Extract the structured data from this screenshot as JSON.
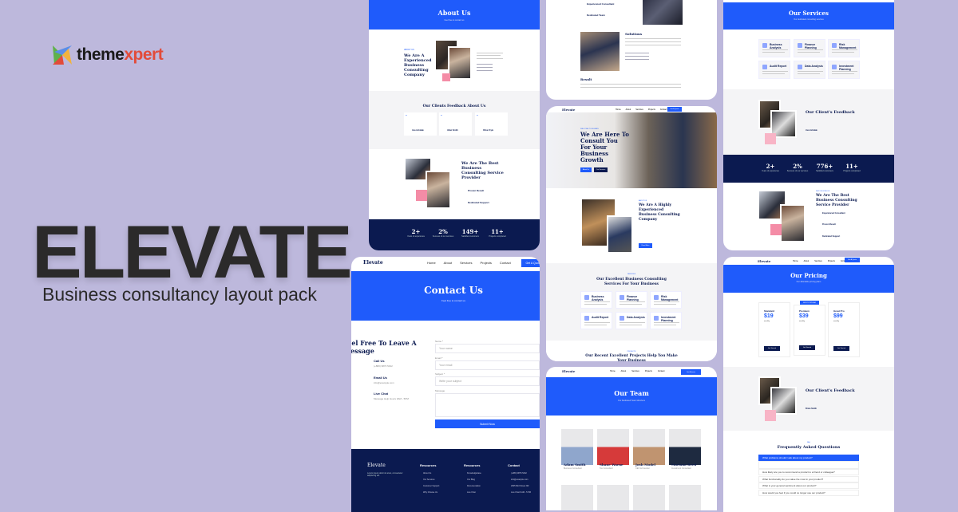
{
  "brand": {
    "logo_text": "themexpert",
    "title": "ELEVATE",
    "subtitle": "Business consultancy layout pack"
  },
  "colors": {
    "background": "#bdb8dc",
    "primary_blue": "#1f5bfb",
    "navy": "#0b1a50",
    "pink": "#f48ca6"
  },
  "about_page": {
    "hero_title": "About Us",
    "hero_sub": "Feel free to contact us",
    "section_tag": "ABOUT US",
    "heading": "We Are A Experienced Business Consulting Company",
    "feedback_tag": "TESTIMONIALS",
    "feedback_title": "Our Clients Feedback About Us",
    "testimonials": [
      {
        "name": "Ava Ashdale",
        "role": "Client"
      },
      {
        "name": "Allan Smith",
        "role": "Client"
      },
      {
        "name": "Oliver Kyle",
        "role": "Client"
      }
    ],
    "best_heading": "We Are The Best Business Consulting Service Provider",
    "features": [
      {
        "title": "Proven Result"
      },
      {
        "title": "Dedicated Support"
      }
    ],
    "stats": [
      {
        "value": "2+",
        "label": "Years of experience"
      },
      {
        "value": "2%",
        "label": "Success of our services"
      },
      {
        "value": "149+",
        "label": "Satisfied customers"
      },
      {
        "value": "11+",
        "label": "Projects completed"
      }
    ]
  },
  "contact_page": {
    "logo": "Elevate",
    "nav": [
      "Home",
      "About",
      "Services",
      "Projects",
      "Contact"
    ],
    "cta": "Get A Quote",
    "hero_title": "Contact Us",
    "hero_sub": "Feel free to contact us",
    "left_heading": "Feel Free To Leave A Message",
    "contacts": [
      {
        "title": "Call Us",
        "value": "(+880) 9876 5432"
      },
      {
        "title": "Email Us",
        "value": "info@example.com"
      },
      {
        "title": "Live Chat",
        "value": "Message Help Hours 9AM - 5PM"
      }
    ],
    "form": {
      "name_label": "Name *",
      "name_placeholder": "Your name",
      "email_label": "Email *",
      "email_placeholder": "Your email",
      "subject_label": "Subject *",
      "subject_placeholder": "Write your subject",
      "message_label": "Message",
      "submit": "Submit Now"
    },
    "footer": {
      "logo": "Elevate",
      "about": "Lorem ipsum dolor sit amet, consectetur adipiscing elit.",
      "cols": [
        {
          "title": "Resources",
          "items": [
            "About Us",
            "Our Services",
            "Customer Support",
            "Why Choose Us"
          ]
        },
        {
          "title": "Resources",
          "items": [
            "Knowledgebase",
            "Our Blog",
            "Documentation",
            "Live Chat"
          ]
        },
        {
          "title": "Contact",
          "items": [
            "(+880) 9876 5432",
            "info@example.com",
            "2905 Bird Street NR",
            "Live Chat 9 AM - 5 PM"
          ]
        }
      ]
    }
  },
  "case_page": {
    "items": [
      "Experienced Consultant",
      "Dedicated Team"
    ],
    "solutions_title": "Solutions",
    "result_title": "Result"
  },
  "home_page": {
    "logo": "Elevate",
    "nav": [
      "Home",
      "About",
      "Services",
      "Projects",
      "Contact"
    ],
    "cta": "Get A Quote",
    "tag": "WELCOME TO ELEVATE",
    "hero_title": "We Are Here To Consult You For Your Business Growth",
    "btn1": "About Us",
    "btn2": "Our Services",
    "about_tag": "ABOUT US",
    "about_heading": "We Are A Highly Experienced Business Consulting Company",
    "read_more": "Read More",
    "services_tag": "SERVICES",
    "services_title": "Our Excellent Business Consulting Services For Your Business",
    "services": [
      "Business Analysis",
      "Finance Planning",
      "Risk Management",
      "Audit Report",
      "Data Analysis",
      "Investment Planning"
    ],
    "projects_tag": "PROJECTS",
    "projects_title": "Our Recent Excellent Projects Help You Make Your Business"
  },
  "team_page": {
    "logo": "Elevate",
    "nav": [
      "Home",
      "About",
      "Services",
      "Projects",
      "Contact"
    ],
    "cta": "Get A Quote",
    "hero_title": "Our Team",
    "hero_sub": "Our Dedicated Team Members",
    "members": [
      {
        "name": "Adam Smith",
        "role": "Business Consultant"
      },
      {
        "name": "Shane Warne",
        "role": "Tax Consultant"
      },
      {
        "name": "Josh Model",
        "role": "CEO & Founder"
      },
      {
        "name": "Mariana Reed",
        "role": "Investment Consultant"
      }
    ]
  },
  "services_page": {
    "hero_title": "Our Services",
    "hero_sub": "Our dedicated consulting services",
    "services": [
      "Business Analysis",
      "Finance Planning",
      "Risk Management",
      "Audit Report",
      "Data Analysis",
      "Investment Planning"
    ],
    "feedback_title": "Our Client's Feedback",
    "feedback_name": "Ava Ashdale",
    "stats": [
      {
        "value": "2+",
        "label": "Years of experience"
      },
      {
        "value": "2%",
        "label": "Success of our services"
      },
      {
        "value": "776+",
        "label": "Satisfied customers"
      },
      {
        "value": "11+",
        "label": "Projects completed"
      }
    ],
    "best_tag": "WHY CHOOSE US",
    "best_heading": "We Are The Best Business Consulting Service Provider",
    "features": [
      "Experienced Consultant",
      "Proven Result",
      "Dedicated Support"
    ]
  },
  "pricing_page": {
    "logo": "Elevate",
    "nav": [
      "Home",
      "About",
      "Services",
      "Projects",
      "Contact"
    ],
    "cta": "Get A Quote",
    "hero_title": "Our Pricing",
    "hero_sub": "Our affordable pricing plans",
    "badge": "MOST POPULAR",
    "plans": [
      {
        "name": "Standard",
        "price": "$19",
        "period": "monthly",
        "button": "Get Started"
      },
      {
        "name": "Premium",
        "price": "$39",
        "period": "monthly",
        "button": "Get Started"
      },
      {
        "name": "Great Pro",
        "price": "$99",
        "period": "monthly",
        "button": "Get Started"
      }
    ],
    "feedback_title": "Our Client's Feedback",
    "feedback_name": "Brian Smith",
    "faq_tag": "FAQ",
    "faq_title": "Frequently Asked Questions",
    "faqs": [
      "What problems should I ask about my product?",
      "How likely are you to recommend a product to a friend or colleague?",
      "What functionality do you value the most in your product?",
      "What is your general sentiment about our product?",
      "How would you feel if you could no longer use our product?"
    ]
  }
}
